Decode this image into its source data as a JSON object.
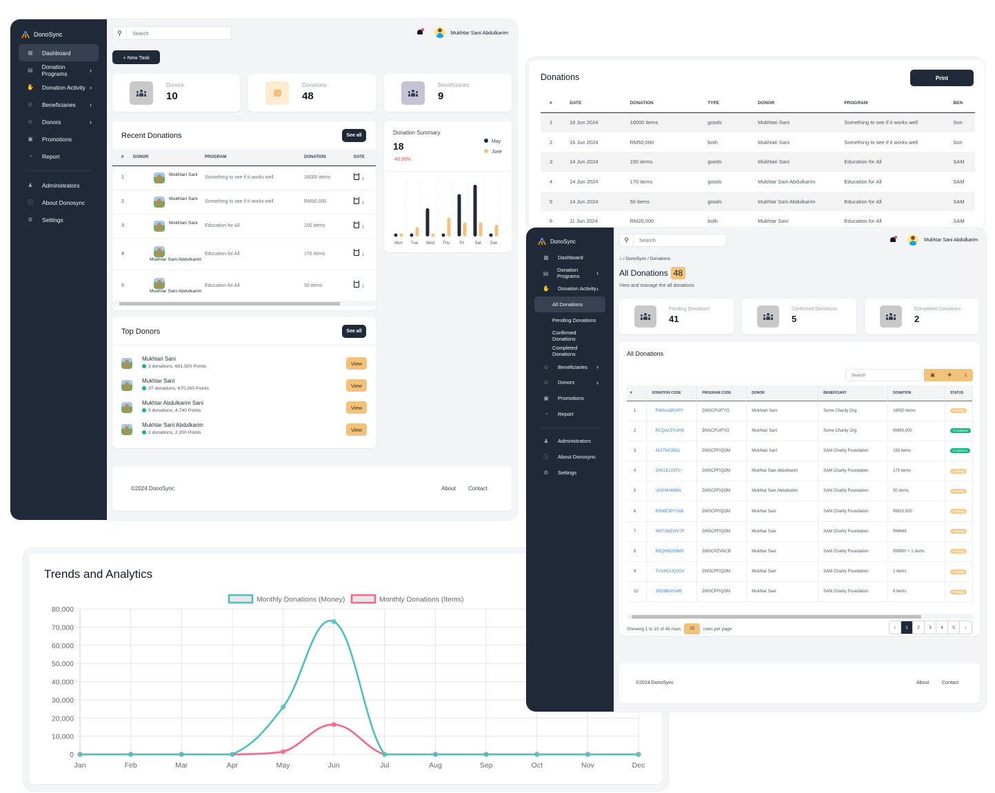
{
  "app": {
    "name": "DonoSync",
    "user_name": "Mukhtar Sani Abdulkarim",
    "search_placeholder": "Search"
  },
  "sidebar": {
    "items": [
      {
        "label": "Dashboard",
        "icon": "grid-icon",
        "has_chevron": false
      },
      {
        "label": "Donation Programs",
        "icon": "programs-icon",
        "has_chevron": true
      },
      {
        "label": "Donation Activity",
        "icon": "hand-donate-icon",
        "has_chevron": true
      },
      {
        "label": "Beneficiaries",
        "icon": "beneficiaries-icon",
        "has_chevron": true
      },
      {
        "label": "Donors",
        "icon": "donors-icon",
        "has_chevron": true
      },
      {
        "label": "Promotions",
        "icon": "promotions-icon",
        "has_chevron": false
      },
      {
        "label": "Report",
        "icon": "pie-chart-icon",
        "has_chevron": false
      }
    ],
    "secondary": [
      {
        "label": "Administrators",
        "icon": "admin-icon"
      },
      {
        "label": "About Donosync",
        "icon": "info-icon"
      },
      {
        "label": "Settings",
        "icon": "gear-icon"
      }
    ],
    "donation_activity_sub": [
      "All Donations",
      "Pending Donations",
      "Confirmed Donations",
      "Completed Donations"
    ]
  },
  "dashboard": {
    "new_task_label": "+ New Task",
    "stats": [
      {
        "label": "Donors",
        "value": "10"
      },
      {
        "label": "Donations",
        "value": "48"
      },
      {
        "label": "Beneficiaries",
        "value": "9"
      }
    ],
    "recent_donations": {
      "title": "Recent Donations",
      "see_all": "See all",
      "columns": [
        "#",
        "DONOR",
        "PROGRAM",
        "DONATION",
        "DATE"
      ],
      "rows": [
        {
          "n": "1",
          "donor": "Mukhtari Sani",
          "program": "Something to see if it works well",
          "donation": "16000 items",
          "date": "1"
        },
        {
          "n": "2",
          "donor": "Mukhtari Sani",
          "program": "Something to see if it works well",
          "donation": "RM50,000",
          "date": "1"
        },
        {
          "n": "3",
          "donor": "Mukhtari Sani",
          "program": "Education for All",
          "donation": "150 items",
          "date": "1"
        },
        {
          "n": "4",
          "donor": "Mukhtar Sani Abdulkarim",
          "program": "Education for All",
          "donation": "170 items",
          "date": "1"
        },
        {
          "n": "5",
          "donor": "Mukhtar Sani Abdulkarim",
          "program": "Education for All",
          "donation": "50 items",
          "date": "1"
        }
      ]
    },
    "donation_summary": {
      "title": "Donation Summary",
      "value": "18",
      "change": "-40.00%",
      "legend": [
        {
          "name": "May",
          "color": "#1f2937"
        },
        {
          "name": "June",
          "color": "#f2c27b"
        }
      ],
      "days": [
        "Mon",
        "Tue",
        "Wed",
        "Thu",
        "Fri",
        "Sat",
        "Sun"
      ],
      "may": [
        0,
        0,
        6,
        0,
        9,
        11,
        0
      ],
      "june": [
        0,
        2,
        0,
        4,
        3,
        3,
        2.5
      ]
    },
    "top_donors": {
      "title": "Top Donors",
      "see_all": "See all",
      "view_label": "View",
      "items": [
        {
          "name": "Mukhtari Sani",
          "meta": "3 donations, 661,500 Points"
        },
        {
          "name": "Mukhtar Sani",
          "meta": "37 donations, 670,260 Points"
        },
        {
          "name": "Mukhtar Abdulkarim Sani",
          "meta": "5 donations, 4,740 Points"
        },
        {
          "name": "Mukhtar Sani Abdulkarim",
          "meta": "2 donations, 2,200 Points"
        }
      ]
    },
    "footer": {
      "copyright": "©2024 DonoSync",
      "links": [
        "About",
        "Contact"
      ]
    }
  },
  "print_view": {
    "title": "Donations",
    "print_label": "Print",
    "columns": [
      "#",
      "DATE",
      "DONATION",
      "TYPE",
      "DONOR",
      "PROGRAM",
      "BEN"
    ],
    "rows": [
      [
        "1",
        "16 Jun 2024",
        "16000 items",
        "goods",
        "Mukhtari Sani",
        "Something to see if it works well",
        "Son"
      ],
      [
        "2",
        "16 Jun 2024",
        "RM50,000",
        "both",
        "Mukhtari Sani",
        "Something to see if it works well",
        "Son"
      ],
      [
        "3",
        "14 Jun 2024",
        "150 items",
        "goods",
        "Mukhtari Sani",
        "Education for All",
        "SAM"
      ],
      [
        "4",
        "14 Jun 2024",
        "170 items",
        "goods",
        "Mukhtar Sani Abdulkarim",
        "Education for All",
        "SAM"
      ],
      [
        "5",
        "14 Jun 2024",
        "50 items",
        "goods",
        "Mukhtar Sani Abdulkarim",
        "Education for All",
        "SAM"
      ],
      [
        "6",
        "11 Jun 2024",
        "RM20,000",
        "both",
        "Mukhtar Sani",
        "Education for All",
        "SAM"
      ]
    ]
  },
  "all_donations": {
    "breadcrumb": [
      "DonoSync",
      "Donations"
    ],
    "title": "All Donations",
    "count": "48",
    "subtitle": "View and manage the all donations",
    "stats": [
      {
        "label": "Pending Donations",
        "value": "41"
      },
      {
        "label": "Confirmed Donations",
        "value": "5"
      },
      {
        "label": "Completed Donations",
        "value": "2"
      }
    ],
    "table_title": "All Donations",
    "table_search_placeholder": "Search",
    "columns": [
      "#",
      "DONATION CODE",
      "PROGRAM CODE",
      "DONOR",
      "BENEFICIARY",
      "DONATION",
      "STATUS"
    ],
    "rows": [
      [
        "1",
        "FMHAAZKVPY",
        "DNSCPUIFYO",
        "Mukhtari Sani",
        "Some Charity Org",
        "16000 items",
        "Pending"
      ],
      [
        "2",
        "RCQA1SYUHO",
        "DNSCPUIFYO",
        "Mukhtari Sani",
        "Some Charity Org",
        "RM50,000",
        "Completed"
      ],
      [
        "3",
        "41ST6SJ9D1",
        "DNSCPFIQOM",
        "Mukhtari Sani",
        "SAM Charity Foundation",
        "150 items",
        "Confirmed"
      ],
      [
        "4",
        "Z4G1EJX9T0",
        "DNSCPFIQOM",
        "Mukhtar Sani Abdulkarim",
        "SAM Charity Foundation",
        "170 items",
        "Pending"
      ],
      [
        "5",
        "UHX4KI4M8A",
        "DNSCPFIQOM",
        "Mukhtar Sani Abdulkarim",
        "SAM Charity Foundation",
        "50 items",
        "Pending"
      ],
      [
        "6",
        "PGWE3PY1N6",
        "DNSCPFIQOM",
        "Mukhtar Sani",
        "SAM Charity Foundation",
        "RM20,000",
        "Pending"
      ],
      [
        "7",
        "NMTG6EWVTP",
        "DNSCPFIQOM",
        "Mukhtar Sani",
        "SAM Charity Foundation",
        "RM649",
        "Pending"
      ],
      [
        "8",
        "R5QHNG59MX",
        "DNSCPZVNCB",
        "Mukhtar Sani",
        "SAM Charity Foundation",
        "RM800 + 1 items",
        "Pending"
      ],
      [
        "9",
        "TUUHGUQ2GV",
        "DNSCPFIQOM",
        "Mukhtar Sani",
        "SAM Charity Foundation",
        "2 items",
        "Pending"
      ],
      [
        "10",
        "1RD8BAHJ4R",
        "DNSCPFIQOM",
        "Mukhtar Sani",
        "SAM Charity Foundation",
        "6 items",
        "Pending"
      ]
    ],
    "pagination": {
      "showing": "Showing 1 to 10 of 48 rows",
      "per_page": "10",
      "per_page_suffix": "rows per page",
      "pages": [
        "1",
        "2",
        "3",
        "4",
        "5"
      ],
      "current": "1"
    },
    "footer": {
      "copyright": "©2024 DonoSync",
      "links": [
        "About",
        "Contact"
      ]
    }
  },
  "chart_data": {
    "type": "line",
    "title": "Trends and Analytics",
    "categories": [
      "Jan",
      "Feb",
      "Mar",
      "Apr",
      "May",
      "Jun",
      "Jul",
      "Aug",
      "Sep",
      "Oct",
      "Nov",
      "Dec"
    ],
    "series": [
      {
        "name": "Monthly Donations (Money)",
        "color": "#4bc0c0",
        "values": [
          0,
          0,
          0,
          0,
          26000,
          73000,
          0,
          0,
          0,
          0,
          0,
          0
        ]
      },
      {
        "name": "Monthly Donations (Items)",
        "color": "#ff6384",
        "values": [
          0,
          0,
          0,
          0,
          1500,
          16400,
          0,
          0,
          0,
          0,
          0,
          0
        ]
      }
    ],
    "ylim": [
      0,
      80000
    ],
    "yticks": [
      "0",
      "10,000",
      "20,000",
      "30,000",
      "40,000",
      "50,000",
      "60,000",
      "70,000",
      "80,000"
    ],
    "grid": true,
    "legend": "top-center",
    "xlabel": "",
    "ylabel": ""
  }
}
